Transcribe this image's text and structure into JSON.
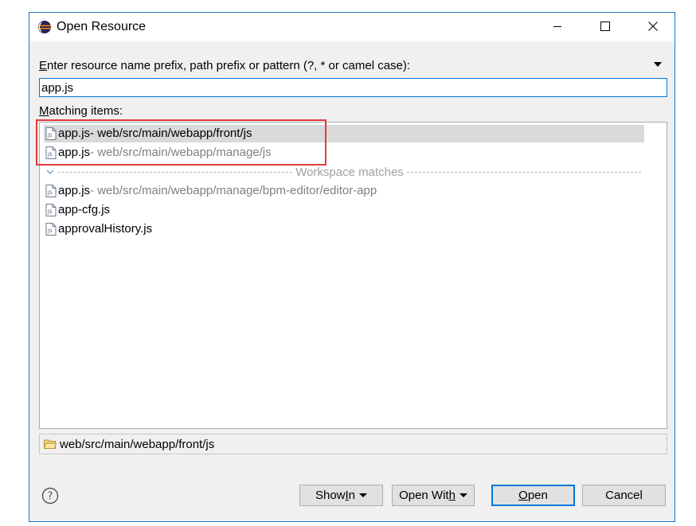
{
  "window": {
    "title": "Open Resource",
    "controls": {
      "minimize": "minimize",
      "maximize": "maximize",
      "close": "close"
    }
  },
  "prompt": {
    "mnemonic": "E",
    "rest": "nter resource name prefix, path prefix or pattern (?, * or camel case):"
  },
  "search": {
    "value": "app.js"
  },
  "matching": {
    "mnemonic": "M",
    "rest": "atching items:"
  },
  "items": [
    {
      "name": "app.js",
      "path": " - web/src/main/webapp/front/js",
      "selected": true
    },
    {
      "name": "app.js",
      "path": " - web/src/main/webapp/manage/js",
      "selected": false
    }
  ],
  "workspace_separator": "Workspace matches",
  "workspace_items": [
    {
      "name": "app.js",
      "path": " - web/src/main/webapp/manage/bpm-editor/editor-app"
    },
    {
      "name": "app-cfg.js",
      "path": ""
    },
    {
      "name": "approvalHistory.js",
      "path": ""
    }
  ],
  "status": {
    "path": "web/src/main/webapp/front/js"
  },
  "buttons": {
    "show_in": {
      "pre": "Show ",
      "mn": "I",
      "post": "n"
    },
    "open_with": {
      "pre": "Open Wit",
      "mn": "h",
      "post": ""
    },
    "open": {
      "pre": "",
      "mn": "O",
      "post": "pen"
    },
    "cancel": "Cancel"
  },
  "colors": {
    "accent": "#0078d7",
    "window_border": "#1979ca",
    "highlight": "#e3393a",
    "selection": "#d9d9d9"
  },
  "icons": {
    "app": "eclipse-icon",
    "file": "js-file-icon",
    "folder": "folder-icon",
    "help": "help-icon"
  }
}
